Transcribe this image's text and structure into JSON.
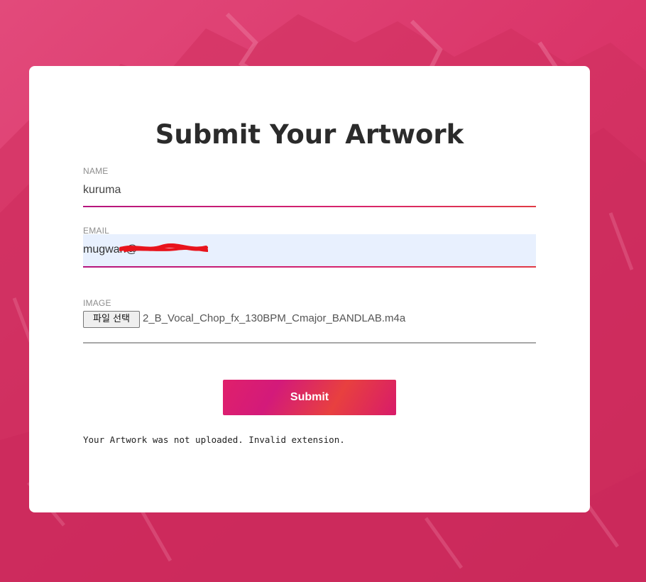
{
  "page": {
    "title": "Submit Your Artwork",
    "background_color": "#d93468"
  },
  "form": {
    "name": {
      "label": "NAME",
      "value": "kuruma"
    },
    "email": {
      "label": "EMAIL",
      "value": "mugwan@",
      "autofill_color": "#e8f0fe",
      "redacted": true
    },
    "image": {
      "label": "IMAGE",
      "button_label": "파일 선택",
      "file_name": "2_B_Vocal_Chop_fx_130BPM_Cmajor_BANDLAB.m4a"
    },
    "submit_label": "Submit",
    "status_message": "Your Artwork was not uploaded. Invalid extension."
  },
  "colors": {
    "accent_gradient_start": "#b5157e",
    "accent_gradient_end": "#e03a45",
    "button_gradient": [
      "#e0206b",
      "#d31a7a",
      "#e8403f"
    ],
    "redaction": "#e8141c"
  },
  "icons": {
    "background": "mountain-photo"
  }
}
